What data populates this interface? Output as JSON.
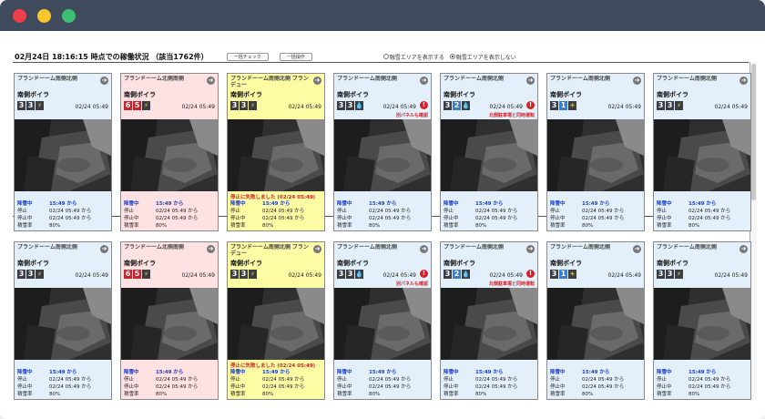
{
  "header": {
    "title": "02月24日 18:16:15 時点での稼働状況 （該当1762件）",
    "btn_check": "一括チェック",
    "btn_ops": "一括操作",
    "radio_show": "融雪エリアを表示する",
    "radio_hide": "融雪エリアを表示しない"
  },
  "labels": {
    "fail": "停止に失敗しました (02/24 05:49)"
  },
  "colors": {
    "blue_card": "#e3f0fb",
    "pink_card": "#fde1e3",
    "yellow_card": "#fdfba4",
    "alert": "#d81f26",
    "active_text": "#1a3fd0"
  },
  "cards": [
    {
      "name": "プランドーーム南側北側",
      "sub": "南側ボイラ",
      "badges": [
        {
          "t": "3",
          "c": "dark"
        },
        {
          "t": "3",
          "c": "dark"
        },
        {
          "t": "⚡",
          "c": "ico"
        }
      ],
      "time": "02/24 05:49",
      "alert": "",
      "fail": false,
      "bg": "blue",
      "info": [
        {
          "k": "降雪中",
          "v": "15:49 から"
        },
        {
          "k": "停止",
          "v": "02/24 05:49 から"
        },
        {
          "k": "停止中",
          "v": "02/24 05:49 から"
        },
        {
          "k": "積雪率",
          "v": "80%"
        }
      ]
    },
    {
      "name": "プランドーーム北側南側",
      "sub": "南側ボイラ",
      "badges": [
        {
          "t": "6",
          "c": "red"
        },
        {
          "t": "5",
          "c": "red"
        },
        {
          "t": "⚡",
          "c": "ico"
        }
      ],
      "time": "02/24 05:49",
      "alert": "",
      "fail": false,
      "bg": "pink",
      "info": [
        {
          "k": "降雪中",
          "v": "15:49 から"
        },
        {
          "k": "停止",
          "v": "02/24 05:49 から"
        },
        {
          "k": "停止中",
          "v": "02/24 05:49 から"
        },
        {
          "k": "積雪率",
          "v": "80%"
        }
      ]
    },
    {
      "name": "プランドーーム南側北側 ブランデュー",
      "sub": "南側ボイラ",
      "badges": [
        {
          "t": "3",
          "c": "dark"
        },
        {
          "t": "3",
          "c": "dark"
        },
        {
          "t": "⚡",
          "c": "ico"
        }
      ],
      "time": "02/24 05:49",
      "alert": "",
      "fail": true,
      "bg": "yellow",
      "info": [
        {
          "k": "降雪中",
          "v": "15:49 から"
        },
        {
          "k": "停止",
          "v": "02/24 05:49 から"
        },
        {
          "k": "停止中",
          "v": "02/24 05:49 から"
        },
        {
          "k": "積雪率",
          "v": "80%"
        }
      ]
    },
    {
      "name": "プランドーーム南側北側",
      "sub": "南側ボイラ",
      "badges": [
        {
          "t": "3",
          "c": "dark"
        },
        {
          "t": "3",
          "c": "dark"
        },
        {
          "t": "💧",
          "c": "ico"
        }
      ],
      "time": "02/24 05:49",
      "alert": "別パネルも確認",
      "fail": false,
      "bg": "blue",
      "info": [
        {
          "k": "降雪中",
          "v": "15:49 から"
        },
        {
          "k": "停止",
          "v": "02/24 05:49 から"
        },
        {
          "k": "停止中",
          "v": "02/24 05:49 から"
        },
        {
          "k": "積雪率",
          "v": "80%"
        }
      ]
    },
    {
      "name": "プランドーーム南側北側",
      "sub": "南側ボイラ",
      "badges": [
        {
          "t": "3",
          "c": "dark"
        },
        {
          "t": "2",
          "c": "blue"
        },
        {
          "t": "💧",
          "c": "ico"
        }
      ],
      "time": "02/24 05:49",
      "alert": "北側駐車場と同時運転",
      "fail": false,
      "bg": "blue",
      "info": [
        {
          "k": "降雪中",
          "v": "15:49 から"
        },
        {
          "k": "停止",
          "v": "02/24 05:49 から"
        },
        {
          "k": "停止中",
          "v": "02/24 05:49 から"
        },
        {
          "k": "積雪率",
          "v": "80%"
        }
      ]
    },
    {
      "name": "プランドーーム南側北側",
      "sub": "南側ボイラ",
      "badges": [
        {
          "t": "3",
          "c": "dark"
        },
        {
          "t": "1",
          "c": "blue"
        },
        {
          "t": "☀",
          "c": "ico"
        }
      ],
      "time": "02/24 05:49",
      "alert": "",
      "fail": false,
      "bg": "blue",
      "info": [
        {
          "k": "降雪中",
          "v": "15:49 から"
        },
        {
          "k": "停止",
          "v": "02/24 05:49 から"
        },
        {
          "k": "停止中",
          "v": "02/24 05:49 から"
        },
        {
          "k": "積雪率",
          "v": "80%"
        }
      ]
    },
    {
      "name": "プランドーーム南側北側",
      "sub": "南側ボイラ",
      "badges": [
        {
          "t": "3",
          "c": "dark"
        },
        {
          "t": "3",
          "c": "dark"
        },
        {
          "t": "⚡",
          "c": "ico"
        }
      ],
      "time": "02/24 05:49",
      "alert": "",
      "fail": false,
      "bg": "blue",
      "info": [
        {
          "k": "降雪中",
          "v": "15:49 から"
        },
        {
          "k": "停止",
          "v": "02/24 05:49 から"
        },
        {
          "k": "停止中",
          "v": "02/24 05:49 から"
        },
        {
          "k": "積雪率",
          "v": "80%"
        }
      ]
    },
    {
      "name": "プランドーーム南側北側",
      "sub": "南側ボイラ",
      "badges": [
        {
          "t": "3",
          "c": "dark"
        },
        {
          "t": "3",
          "c": "dark"
        },
        {
          "t": "⚡",
          "c": "ico"
        }
      ],
      "time": "02/24 05:49",
      "alert": "",
      "fail": false,
      "bg": "blue",
      "info": [
        {
          "k": "降雪中",
          "v": "15:49 から"
        },
        {
          "k": "停止",
          "v": "02/24 05:49 から"
        },
        {
          "k": "停止中",
          "v": "02/24 05:49 から"
        },
        {
          "k": "積雪率",
          "v": "80%"
        }
      ]
    },
    {
      "name": "プランドーーム北側南側",
      "sub": "南側ボイラ",
      "badges": [
        {
          "t": "6",
          "c": "red"
        },
        {
          "t": "5",
          "c": "red"
        },
        {
          "t": "⚡",
          "c": "ico"
        }
      ],
      "time": "02/24 05:49",
      "alert": "",
      "fail": false,
      "bg": "pink",
      "info": [
        {
          "k": "降雪中",
          "v": "15:49 から"
        },
        {
          "k": "停止",
          "v": "02/24 05:49 から"
        },
        {
          "k": "停止中",
          "v": "02/24 05:49 から"
        },
        {
          "k": "積雪率",
          "v": "80%"
        }
      ]
    },
    {
      "name": "プランドーーム南側北側 ブランデュー",
      "sub": "南側ボイラ",
      "badges": [
        {
          "t": "3",
          "c": "dark"
        },
        {
          "t": "3",
          "c": "dark"
        },
        {
          "t": "⚡",
          "c": "ico"
        }
      ],
      "time": "02/24 05:49",
      "alert": "",
      "fail": true,
      "bg": "yellow",
      "info": [
        {
          "k": "降雪中",
          "v": "15:49 から"
        },
        {
          "k": "停止",
          "v": "02/24 05:49 から"
        },
        {
          "k": "停止中",
          "v": "02/24 05:49 から"
        },
        {
          "k": "積雪率",
          "v": "80%"
        }
      ]
    },
    {
      "name": "プランドーーム南側北側",
      "sub": "南側ボイラ",
      "badges": [
        {
          "t": "3",
          "c": "dark"
        },
        {
          "t": "3",
          "c": "dark"
        },
        {
          "t": "💧",
          "c": "ico"
        }
      ],
      "time": "02/24 05:49",
      "alert": "別パネルも確認",
      "fail": false,
      "bg": "blue",
      "info": [
        {
          "k": "降雪中",
          "v": "15:49 から"
        },
        {
          "k": "停止",
          "v": "02/24 05:49 から"
        },
        {
          "k": "停止中",
          "v": "02/24 05:49 から"
        },
        {
          "k": "積雪率",
          "v": "80%"
        }
      ]
    },
    {
      "name": "プランドーーム南側北側",
      "sub": "南側ボイラ",
      "badges": [
        {
          "t": "3",
          "c": "dark"
        },
        {
          "t": "2",
          "c": "blue"
        },
        {
          "t": "💧",
          "c": "ico"
        }
      ],
      "time": "02/24 05:49",
      "alert": "北側駐車場と同時運転",
      "fail": false,
      "bg": "blue",
      "info": [
        {
          "k": "降雪中",
          "v": "15:49 から"
        },
        {
          "k": "停止",
          "v": "02/24 05:49 から"
        },
        {
          "k": "停止中",
          "v": "02/24 05:49 から"
        },
        {
          "k": "積雪率",
          "v": "80%"
        }
      ]
    },
    {
      "name": "プランドーーム南側北側",
      "sub": "南側ボイラ",
      "badges": [
        {
          "t": "3",
          "c": "dark"
        },
        {
          "t": "1",
          "c": "blue"
        },
        {
          "t": "☀",
          "c": "ico"
        }
      ],
      "time": "02/24 05:49",
      "alert": "",
      "fail": false,
      "bg": "blue",
      "info": [
        {
          "k": "降雪中",
          "v": "15:49 から"
        },
        {
          "k": "停止",
          "v": "02/24 05:49 から"
        },
        {
          "k": "停止中",
          "v": "02/24 05:49 から"
        },
        {
          "k": "積雪率",
          "v": "80%"
        }
      ]
    },
    {
      "name": "プランドーーム南側北側",
      "sub": "南側ボイラ",
      "badges": [
        {
          "t": "3",
          "c": "dark"
        },
        {
          "t": "3",
          "c": "dark"
        },
        {
          "t": "⚡",
          "c": "ico"
        }
      ],
      "time": "02/24 05:49",
      "alert": "",
      "fail": false,
      "bg": "blue",
      "info": [
        {
          "k": "降雪中",
          "v": "15:49 から"
        },
        {
          "k": "停止",
          "v": "02/24 05:49 から"
        },
        {
          "k": "停止中",
          "v": "02/24 05:49 から"
        },
        {
          "k": "積雪率",
          "v": "80%"
        }
      ]
    }
  ]
}
